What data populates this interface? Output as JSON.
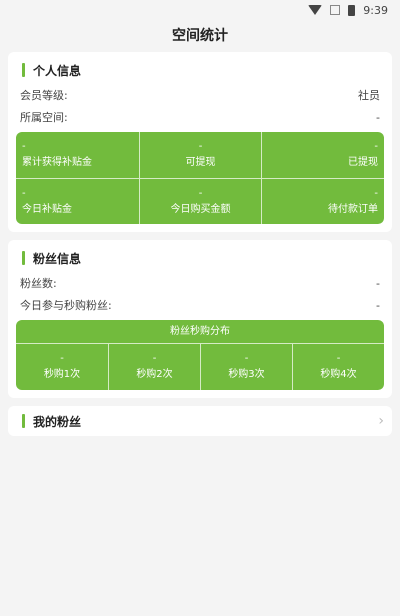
{
  "status": {
    "time": "9:39"
  },
  "header": {
    "title": "空间统计"
  },
  "personal": {
    "title": "个人信息",
    "member_level_label": "会员等级:",
    "member_level_value": "社员",
    "space_label": "所属空间:",
    "space_value": "-",
    "stats": [
      {
        "value": "-",
        "label": "累计获得补贴金"
      },
      {
        "value": "-",
        "label": "可提现"
      },
      {
        "value": "-",
        "label": "已提现"
      },
      {
        "value": "-",
        "label": "今日补贴金"
      },
      {
        "value": "-",
        "label": "今日购买金额"
      },
      {
        "value": "-",
        "label": "待付款订单"
      }
    ]
  },
  "fans": {
    "title": "粉丝信息",
    "count_label": "粉丝数:",
    "count_value": "-",
    "today_label": "今日参与秒购粉丝:",
    "today_value": "-",
    "distribution_title": "粉丝秒购分布",
    "distribution": [
      {
        "value": "-",
        "label": "秒购1次"
      },
      {
        "value": "-",
        "label": "秒购2次"
      },
      {
        "value": "-",
        "label": "秒购3次"
      },
      {
        "value": "-",
        "label": "秒购4次"
      }
    ]
  },
  "my_fans": {
    "label": "我的粉丝"
  }
}
